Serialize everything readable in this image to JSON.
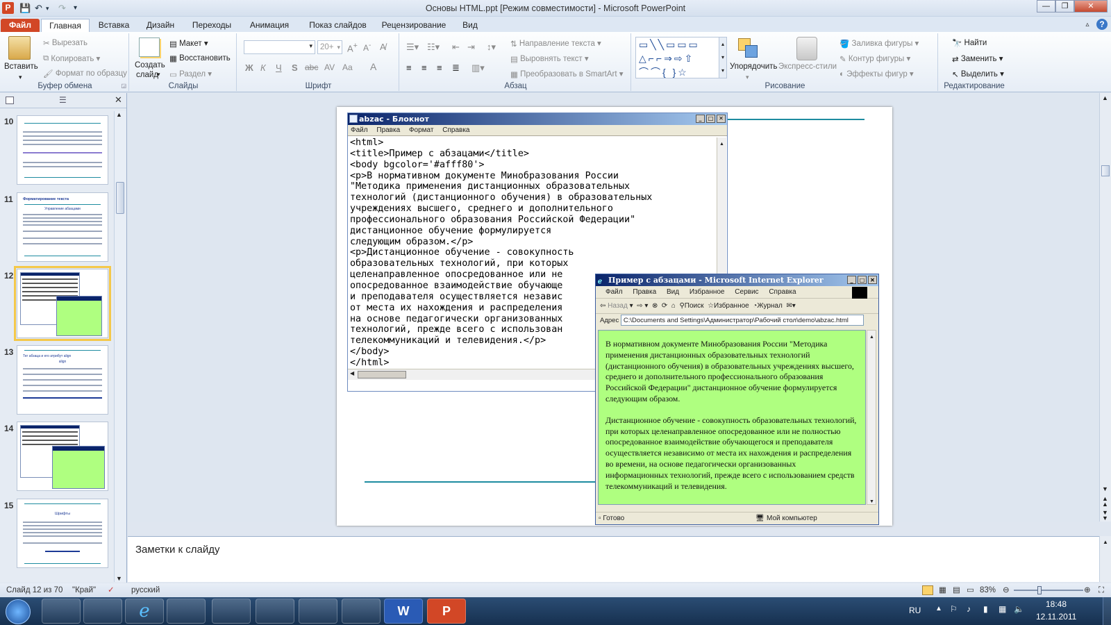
{
  "window": {
    "title": "Основы HTML.ppt [Режим совместимости]  -  Microsoft PowerPoint"
  },
  "tabs": [
    {
      "label": "Файл"
    },
    {
      "label": "Главная"
    },
    {
      "label": "Вставка"
    },
    {
      "label": "Дизайн"
    },
    {
      "label": "Переходы"
    },
    {
      "label": "Анимация"
    },
    {
      "label": "Показ слайдов"
    },
    {
      "label": "Рецензирование"
    },
    {
      "label": "Вид"
    }
  ],
  "ribbon": {
    "clipboard": {
      "paste": "Вставить",
      "cut": "Вырезать",
      "copy": "Копировать",
      "format_painter": "Формат по образцу",
      "label": "Буфер обмена"
    },
    "slides": {
      "new_slide_line1": "Создать",
      "new_slide_line2": "слайд",
      "layout": "Макет",
      "reset": "Восстановить",
      "section": "Раздел",
      "label": "Слайды"
    },
    "font": {
      "name_value": "",
      "size_value": "20+",
      "label": "Шрифт",
      "bold": "Ж",
      "italic": "К",
      "underline": "Ч",
      "strike": "S",
      "abc": "abc",
      "aa": "Aa",
      "a": "A"
    },
    "paragraph": {
      "text_direction": "Направление текста",
      "align_text": "Выровнять текст",
      "smartart": "Преобразовать в SmartArt",
      "label": "Абзац"
    },
    "drawing": {
      "arrange": "Упорядочить",
      "quick_styles": "Экспресс-стили",
      "shape_fill": "Заливка фигуры",
      "shape_outline": "Контур фигуры",
      "shape_effects": "Эффекты фигур",
      "label": "Рисование"
    },
    "editing": {
      "find": "Найти",
      "replace": "Заменить",
      "select": "Выделить",
      "label": "Редактирование"
    }
  },
  "thumbnails": [
    {
      "num": "10"
    },
    {
      "num": "11",
      "title": "Форматирование текста",
      "subtitle": "Управление абзацами"
    },
    {
      "num": "12"
    },
    {
      "num": "13",
      "title": "Тег абзаца и его атрибут align",
      "subtitle": "align"
    },
    {
      "num": "14"
    },
    {
      "num": "15",
      "title": "Шрифты"
    }
  ],
  "notepad": {
    "title": "abzac - Блокнот",
    "menu": [
      "Файл",
      "Правка",
      "Формат",
      "Справка"
    ],
    "content": "<html>\n<title>Пример с абзацами</title>\n<body bgcolor='#afff80'>\n<p>В нормативном документе Минобразования России\n\"Методика применения дистанционных образовательных\nтехнологий (дистанционного обучения) в образовательных\nучреждениях высшего, среднего и дополнительного\nпрофессионального образования Российской Федерации\"\nдистанционное обучение формулируется\nследующим образом.</p>\n<p>Дистанционное обучение - совокупность\nобразовательных технологий, при которых\nцеленаправленное опосредованное или не\nопосредованное взаимодействие обучающе\nи преподавателя осуществляется независ\nот места их нахождения и распределения\nна основе педагогически организованных\nтехнологий, прежде всего с использован\nтелекоммуникаций и телевидения.</p>\n</body>\n</html>"
  },
  "ie": {
    "title": "Пример с абзацами - Microsoft Internet Explorer",
    "menu": [
      "Файл",
      "Правка",
      "Вид",
      "Избранное",
      "Сервис",
      "Справка"
    ],
    "back": "Назад",
    "search": "Поиск",
    "favorites": "Избранное",
    "journal": "Журнал",
    "address_label": "Адрес",
    "address": "C:\\Documents and Settings\\Администратор\\Рабочий стол\\demo\\abzac.html",
    "paragraph1": "В нормативном документе Минобразования России \"Методика применения дистанционных образовательных технологий (дистанционного обучения) в образовательных учреждениях высшего, среднего и дополнительного профессионального образования Российской Федерации\" дистанционное обучение формулируется следующим образом.",
    "paragraph2": "Дистанционное обучение - совокупность образовательных технологий, при которых целенаправленное опосредованное или не полностью опосредованное взаимодействие обучающегося и преподавателя осуществляется независимо от места их нахождения и распределения во времени, на основе педагогически организованных информационных технологий, прежде всего с использованием средств телекоммуникаций и телевидения.",
    "status": "Готово",
    "zone": "Мой компьютер",
    "bg_color": "#afff80"
  },
  "notes": {
    "placeholder": "Заметки к слайду"
  },
  "statusbar": {
    "slide": "Слайд 12 из 70",
    "theme": "\"Край\"",
    "language": "русский",
    "zoom": "83%"
  },
  "taskbar": {
    "lang": "RU",
    "time": "18:48",
    "date": "12.11.2011"
  }
}
